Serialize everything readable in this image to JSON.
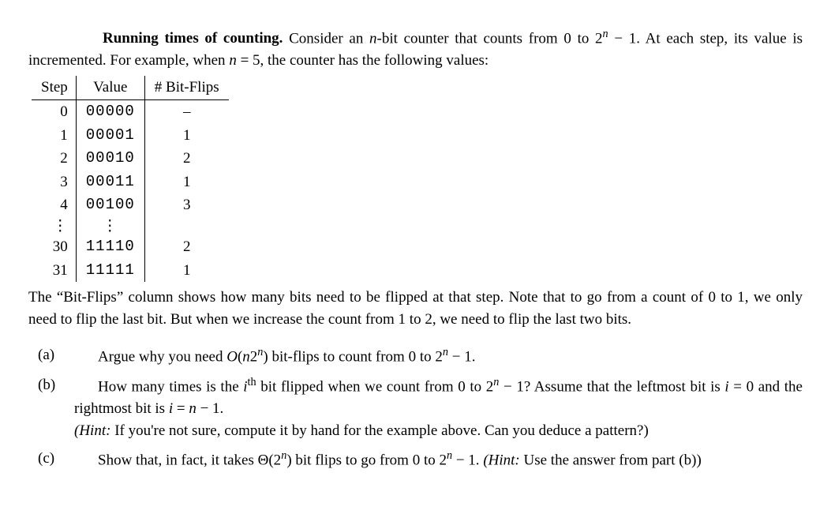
{
  "title": "Running times of counting.",
  "intro_a": "Consider an ",
  "intro_b": "-bit counter that counts from 0 to 2",
  "intro_c": " − 1.  At each step, its value is incremented. For example, when ",
  "intro_d": " = 5, the counter has the following values:",
  "headers": {
    "step": "Step",
    "value": "Value",
    "flips": "# Bit-Flips"
  },
  "rows": [
    {
      "step": "0",
      "value": "00000",
      "flips": "–"
    },
    {
      "step": "1",
      "value": "00001",
      "flips": "1"
    },
    {
      "step": "2",
      "value": "00010",
      "flips": "2"
    },
    {
      "step": "3",
      "value": "00011",
      "flips": "1"
    },
    {
      "step": "4",
      "value": "00100",
      "flips": "3"
    },
    {
      "step": "⋮",
      "value": "⋮",
      "flips": ""
    },
    {
      "step": "30",
      "value": "11110",
      "flips": "2"
    },
    {
      "step": "31",
      "value": "11111",
      "flips": "1"
    }
  ],
  "explain": "The “Bit-Flips” column shows how many bits need to be flipped at that step. Note that to go from a count of 0 to 1, we only need to flip the last bit. But when we increase the count from 1 to 2, we need to flip the last two bits.",
  "parts": {
    "a": {
      "label": "(a)",
      "t1": "Argue why you need ",
      "t2": "O",
      "t3": "(",
      "t4": "n",
      "t5": "2",
      "t6": "n",
      "t7": ") bit-flips to count from 0 to 2",
      "t8": "n",
      "t9": " − 1."
    },
    "b": {
      "label": "(b)",
      "t1": "How many times is the ",
      "t2": "i",
      "t3": "th",
      "t4": " bit flipped when we count from 0 to 2",
      "t5": "n",
      "t6": " − 1? Assume that the leftmost bit is ",
      "t7": "i",
      "t8": " = 0 and the rightmost bit is ",
      "t9": "i",
      "t10": " = ",
      "t11": "n",
      "t12": " − 1.",
      "hint_lead": "(Hint:",
      "hint_body": " If you're not sure, compute it by hand for the example above. Can you deduce a pattern?)"
    },
    "c": {
      "label": "(c)",
      "t1": "Show that, in fact, it takes Θ(2",
      "t2": "n",
      "t3": ") bit flips to go from 0 to 2",
      "t4": "n",
      "t5": " − 1. ",
      "hint_lead": "(Hint:",
      "hint_body": " Use the answer from part (b))"
    }
  }
}
